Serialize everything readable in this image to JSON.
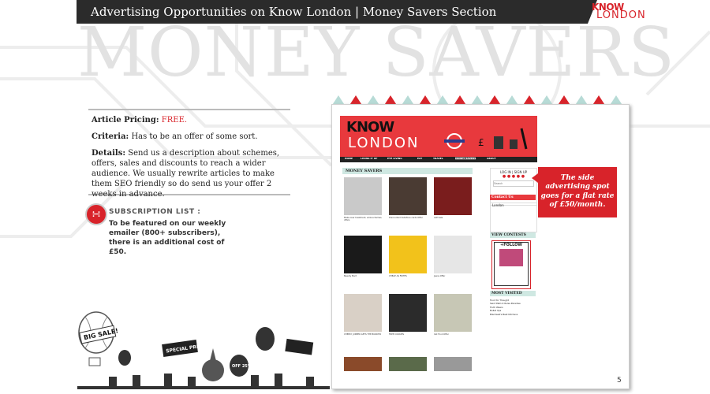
{
  "header": {
    "title": "Advertising Opportunities on Know London | Money Savers Section",
    "logo_know": "KNOW",
    "logo_london": "LONDON"
  },
  "background_title": "MONEY SAVERS",
  "pricing": {
    "article_pricing_label": "Article Pricing:",
    "article_pricing_value": "FREE.",
    "criteria_label": "Criteria:",
    "criteria_text": "Has to be an offer of some sort.",
    "details_label": "Details:",
    "details_text": "Send us a description about schemes, offers, sales and discounts to reach a wider audience. We usually rewrite articles to make them SEO friendly so do send us your offer 2 weeks in advance."
  },
  "subscription": {
    "title": "SUBSCRIPTION LIST :",
    "body": "To be featured on our weekly emailer (800+ subscribers), there is an additional cost of £50."
  },
  "callout": {
    "text": "The side advertising spot goes for a flat rate of £50/month."
  },
  "site": {
    "logo_know": "KNOW",
    "logo_london": "LONDON",
    "nav": [
      "HOME",
      "LIVING IT UP",
      "EYE LIVING",
      "EAT",
      "TRAVEL",
      "MONEY SAVERS",
      "ABOUT"
    ],
    "section_heading": "MONEY SAVERS",
    "login_text": "LOG IN | SIGN UP",
    "search_placeholder": "Search",
    "contact_heading": "Contact Us",
    "weather_city": "London",
    "view_contests": "VIEW CONTESTS",
    "follow_text": "+FOLLOW",
    "most_visited": "MOST VISITED",
    "most_visited_items": [
      "Food for Thought",
      "Saint Patrick Rules Paradise",
      "Truth Wears",
      "Bullet Ups",
      "Blackwell's Best Kitchens"
    ],
    "thumbs": [
      {
        "caption": "Make-over treatment, wide schemes, offers"
      },
      {
        "caption": "Discounted Vodafone cards Offer"
      },
      {
        "caption": "ALE Sale"
      },
      {
        "caption": "Beauty Mart"
      },
      {
        "caption": "CHEAP AS FRITES"
      },
      {
        "caption": "Jeans Offer"
      },
      {
        "caption": "CHEEKY JUMPER GETS THE BURRITO"
      },
      {
        "caption": "FREE COOKIES"
      },
      {
        "caption": "Cat Food Offer"
      }
    ]
  },
  "art": {
    "big_sale": "BIG SALE!",
    "special_price": "SPECIAL PRICE!",
    "off_25": "OFF 25%"
  },
  "page_number": "5"
}
